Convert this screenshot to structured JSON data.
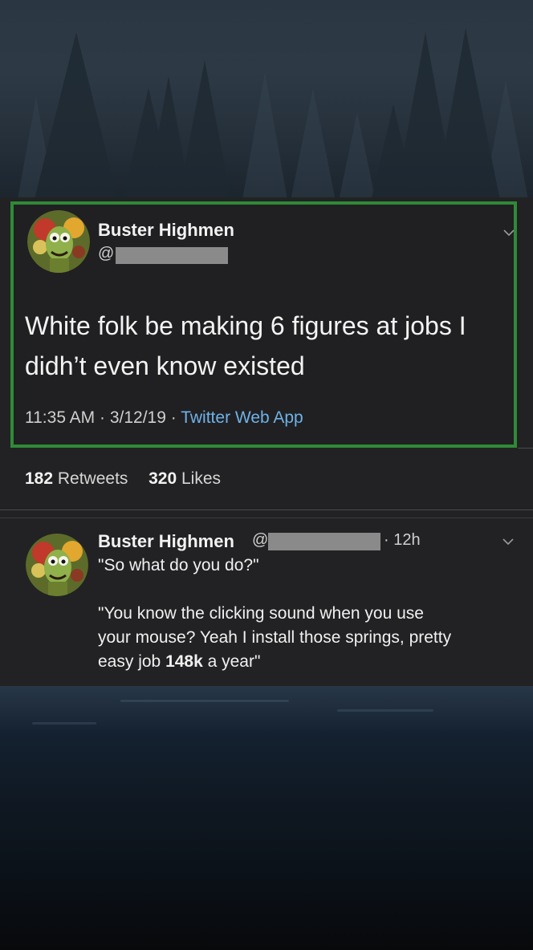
{
  "main_tweet": {
    "author_name": "Buster Highmen",
    "handle_prefix": "@",
    "text_line1": "White folk be making 6 figures at jobs I",
    "text_line2": "didh’t even know existed",
    "time": "11:35 AM",
    "sep1": " · ",
    "date": "3/12/19",
    "sep2": " · ",
    "client": "Twitter Web App",
    "retweets_count": "182",
    "retweets_label": " Retweets",
    "likes_count": "320",
    "likes_label": " Likes"
  },
  "reply_tweet": {
    "author_name": "Buster Highmen",
    "handle_prefix": "@",
    "time_ago": "· 12h",
    "line1": "\"So what do you do?\"",
    "line2": "\"You know the clicking sound when you use",
    "line3": "your mouse? Yeah I install those springs, pretty",
    "line4_pre": "easy job ",
    "line4_bold": "148k",
    "line4_post": " a year\""
  },
  "colors": {
    "highlight_border": "#2f8a36",
    "link": "#6fb2e8",
    "panel": "#222224"
  },
  "icons": {
    "menu": "chevron-down-icon",
    "avatar": "cartoon-avatar"
  }
}
